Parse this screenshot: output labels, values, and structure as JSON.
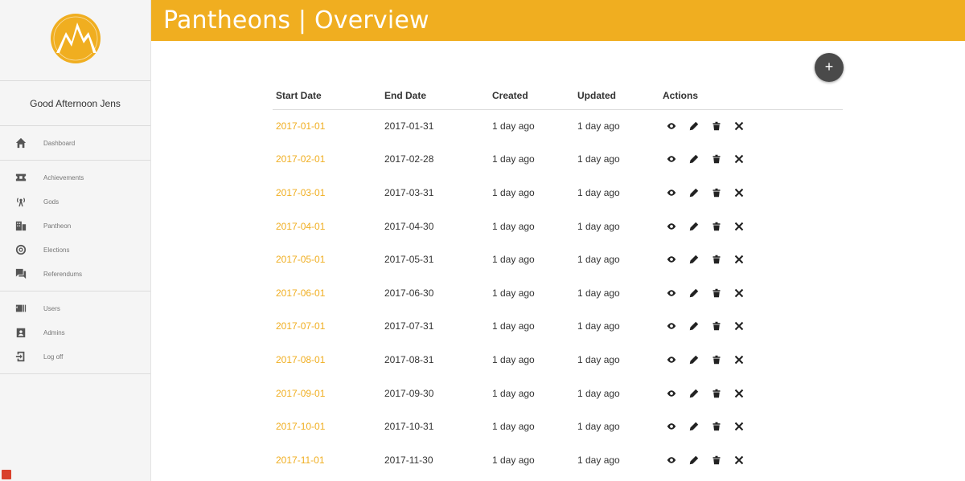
{
  "header": {
    "title": "Pantheons | Overview"
  },
  "sidebar": {
    "greeting": "Good Afternoon Jens",
    "groups": [
      [
        {
          "label": "Dashboard",
          "icon": "home-icon"
        }
      ],
      [
        {
          "label": "Achievements",
          "icon": "ticket-icon"
        },
        {
          "label": "Gods",
          "icon": "antenna-icon"
        },
        {
          "label": "Pantheon",
          "icon": "building-icon"
        },
        {
          "label": "Elections",
          "icon": "target-icon"
        },
        {
          "label": "Referendums",
          "icon": "chat-icon"
        }
      ],
      [
        {
          "label": "Users",
          "icon": "users-icon"
        },
        {
          "label": "Admins",
          "icon": "admin-icon"
        },
        {
          "label": "Log off",
          "icon": "logoff-icon"
        }
      ]
    ]
  },
  "fab": {
    "label": "+"
  },
  "table": {
    "headers": [
      "Start Date",
      "End Date",
      "Created",
      "Updated",
      "Actions"
    ],
    "rows": [
      [
        "2017-01-01",
        "2017-01-31",
        "1 day ago",
        "1 day ago"
      ],
      [
        "2017-02-01",
        "2017-02-28",
        "1 day ago",
        "1 day ago"
      ],
      [
        "2017-03-01",
        "2017-03-31",
        "1 day ago",
        "1 day ago"
      ],
      [
        "2017-04-01",
        "2017-04-30",
        "1 day ago",
        "1 day ago"
      ],
      [
        "2017-05-01",
        "2017-05-31",
        "1 day ago",
        "1 day ago"
      ],
      [
        "2017-06-01",
        "2017-06-30",
        "1 day ago",
        "1 day ago"
      ],
      [
        "2017-07-01",
        "2017-07-31",
        "1 day ago",
        "1 day ago"
      ],
      [
        "2017-08-01",
        "2017-08-31",
        "1 day ago",
        "1 day ago"
      ],
      [
        "2017-09-01",
        "2017-09-30",
        "1 day ago",
        "1 day ago"
      ],
      [
        "2017-10-01",
        "2017-10-31",
        "1 day ago",
        "1 day ago"
      ],
      [
        "2017-11-01",
        "2017-11-30",
        "1 day ago",
        "1 day ago"
      ]
    ]
  },
  "colors": {
    "accent": "#f0ae20",
    "fab": "#4a4a4a"
  }
}
